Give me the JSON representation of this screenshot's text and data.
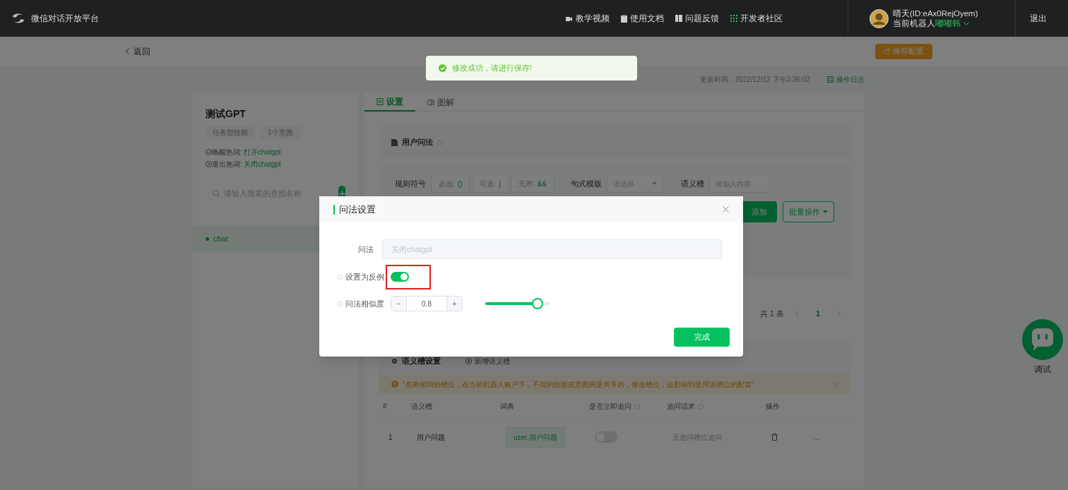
{
  "nav": {
    "logo_text": "微信对话开放平台",
    "links": [
      {
        "label": "教学视频"
      },
      {
        "label": "使用文档"
      },
      {
        "label": "问题反馈"
      },
      {
        "label": "开发者社区"
      }
    ],
    "user": {
      "name": "晴天(ID:eAx0RejOyem)",
      "robot_label": "当前机器人",
      "robot_name": "嘟嘟韩"
    },
    "logout": "退出"
  },
  "toolbar": {
    "back": "返回",
    "save": "保存配置"
  },
  "toast": {
    "text": "修改成功，请进行保存!"
  },
  "meta": {
    "updated": "更新时间：2022/12/12 下午3:36:02",
    "log": "操作日志"
  },
  "skill": {
    "title": "测试GPT",
    "tags": [
      "任务型技能",
      "1个意图"
    ],
    "wake": {
      "label": "唤醒热词:",
      "value": "打开chatgpt"
    },
    "exit": {
      "label": "退出热词:",
      "value": "关闭chatgpt"
    },
    "search_placeholder": "请输入搜索的意图名称",
    "intents": [
      {
        "name": "chat",
        "selected": true
      }
    ]
  },
  "tabs": [
    {
      "label": "设置",
      "selected": true
    },
    {
      "label": "图解",
      "selected": false
    }
  ],
  "user_questions": {
    "title": "用户问法",
    "rules_label": "规则符号",
    "symbols": [
      {
        "label": "必选:",
        "value": "()"
      },
      {
        "label": "可选:",
        "value": "|"
      },
      {
        "label": "无序:",
        "value": "&&"
      }
    ],
    "template": {
      "label": "句式模版",
      "placeholder": "请选择"
    },
    "slot": {
      "label": "语义槽",
      "placeholder": "请输入内容"
    },
    "add": "添加",
    "batch": "批量操作"
  },
  "pagination": {
    "total": "共 1 条",
    "page": "1"
  },
  "slots": {
    "title": "语义槽设置",
    "add": "新增语义槽",
    "alert": "\"名称相同的槽位，在当前机器人账户下，不同的技能或意图间是共享的，修改槽位，会影响到使用该槽位的配置\"",
    "columns": [
      "#",
      "语义槽",
      "词典",
      "是否立即追问",
      "追问话术",
      "操作"
    ],
    "rows": [
      {
        "index": "1",
        "slot": "用户问题",
        "dict": "user.用户问题",
        "ask_now": false,
        "ask_text": "无追问槽位追问",
        "more": "..."
      }
    ]
  },
  "dialog": {
    "title": "问法设置",
    "question": {
      "label": "问法",
      "value": "关闭chatgpt"
    },
    "negative": {
      "label": "设置为反例",
      "on": true,
      "highlighted": true
    },
    "similarity": {
      "label": "问法相似度",
      "value": "0.8",
      "minus": "−",
      "plus": "+",
      "level": 0.8
    },
    "done": "完成"
  },
  "debug": {
    "label": "调试"
  }
}
